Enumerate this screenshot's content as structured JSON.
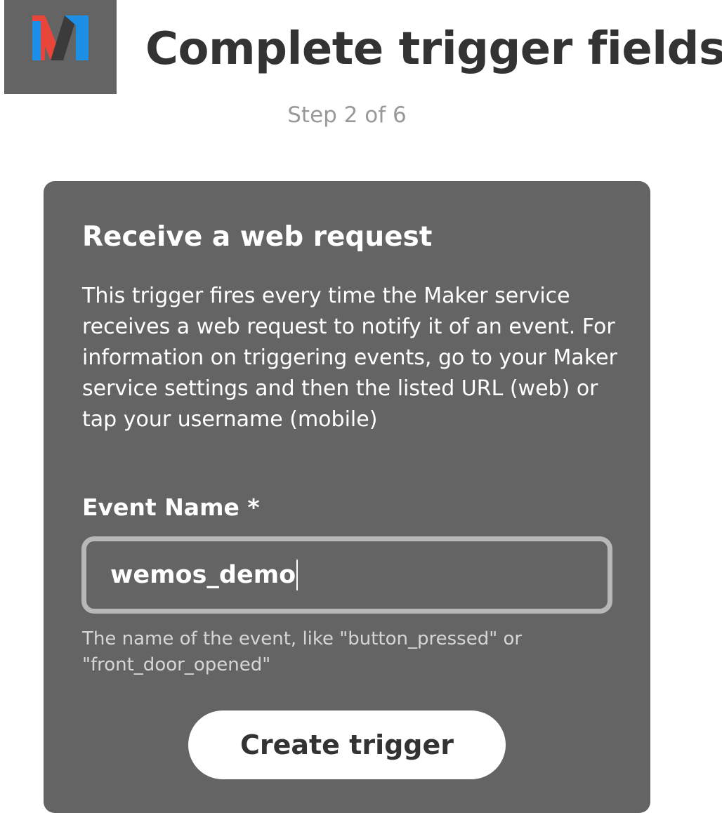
{
  "header": {
    "logo_icon": "maker-logo-icon",
    "title": "Complete trigger fields",
    "step": "Step 2 of 6"
  },
  "trigger_card": {
    "title": "Receive a web request",
    "description": "This trigger fires every time the Maker service receives a web request to notify it of an event. For information on triggering events, go to your Maker service settings and then the listed URL (web) or tap your username (mobile)",
    "field": {
      "label": "Event Name *",
      "value": "wemos_demo",
      "help": "The name of the event, like \"button_pressed\" or \"front_door_opened\""
    },
    "button_label": "Create trigger"
  },
  "colors": {
    "card_background": "#646464",
    "title_text": "#333333",
    "step_text": "#999999",
    "logo_red": "#e8463b",
    "logo_blue": "#1e8fe6",
    "logo_dark": "#3b3b3b"
  }
}
